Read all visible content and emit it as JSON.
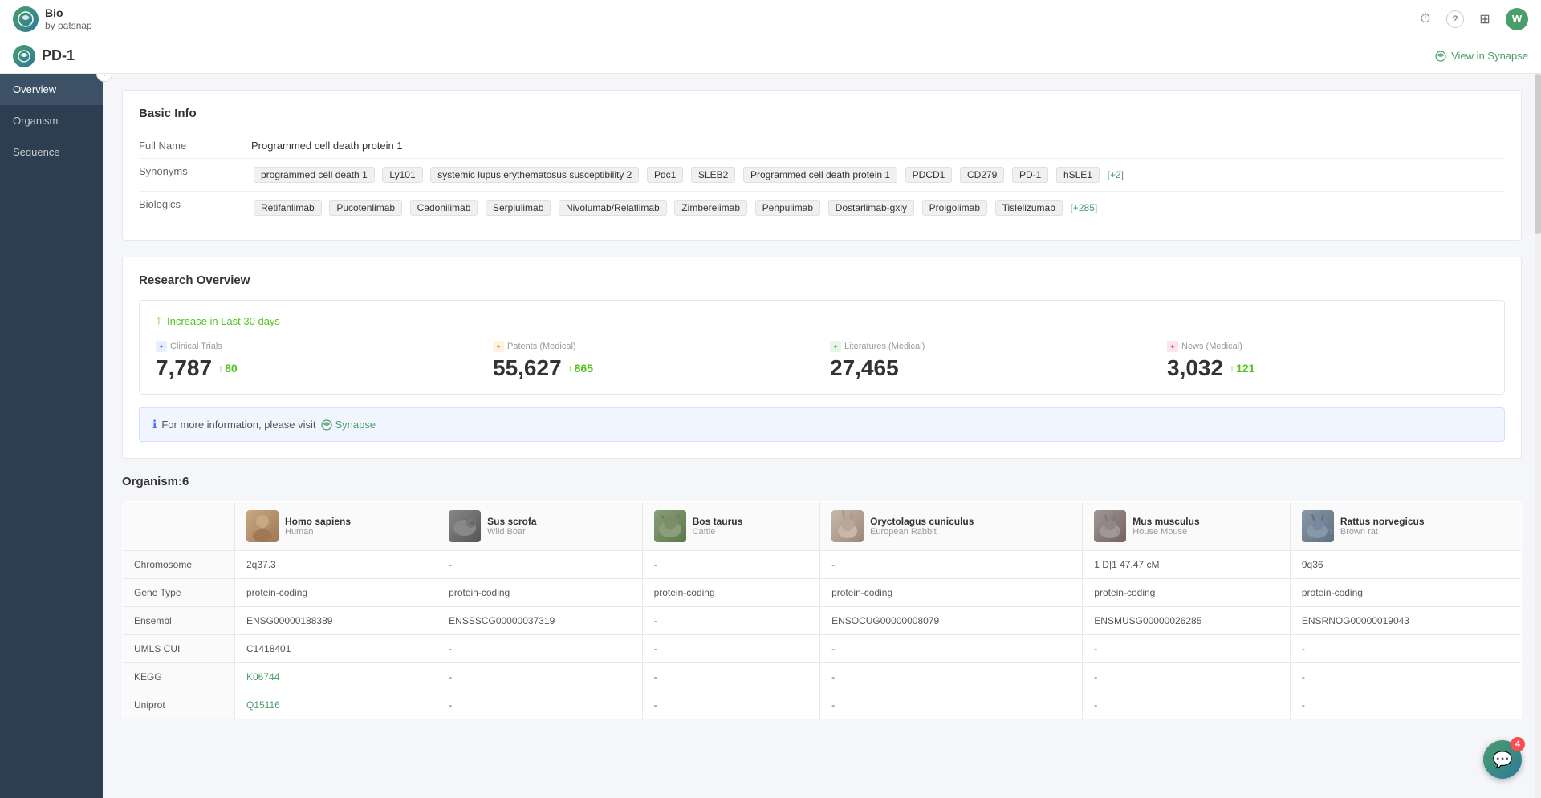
{
  "app": {
    "name": "Bio",
    "subtitle": "by patsnap",
    "avatar": "W",
    "page_title": "PD-1",
    "view_synapse_label": "View in Synapse"
  },
  "nav_icons": {
    "clock": "⏱",
    "help": "?",
    "grid": "⊞"
  },
  "sidebar": {
    "items": [
      {
        "id": "overview",
        "label": "Overview",
        "active": true
      },
      {
        "id": "organism",
        "label": "Organism",
        "active": false
      },
      {
        "id": "sequence",
        "label": "Sequence",
        "active": false
      }
    ],
    "collapse_icon": "‹"
  },
  "basic_info": {
    "section_title": "Basic Info",
    "full_name_label": "Full Name",
    "full_name_value": "Programmed cell death protein 1",
    "synonyms_label": "Synonyms",
    "synonyms": [
      "programmed cell death 1",
      "Ly101",
      "systemic lupus erythematosus susceptibility 2",
      "Pdc1",
      "SLEB2",
      "Programmed cell death protein 1",
      "PDCD1",
      "CD279",
      "PD-1",
      "hSLE1"
    ],
    "synonyms_more": "[+2]",
    "biologics_label": "Biologics",
    "biologics": [
      "Retifanlimab",
      "Pucotenlimab",
      "Cadonilimab",
      "Serplulimab",
      "Nivolumab/Relatlimab",
      "Zimberelimab",
      "Penpulimab",
      "Dostarlimab-gxly",
      "Prolgolimab",
      "Tislelizumab"
    ],
    "biologics_more": "[+285]"
  },
  "research_overview": {
    "section_title": "Research Overview",
    "increase_label": "Increase in Last 30 days",
    "stats": [
      {
        "id": "clinical_trials",
        "label": "Clinical Trials",
        "value": "7,787",
        "delta": "80",
        "icon": "CT"
      },
      {
        "id": "patents",
        "label": "Patents (Medical)",
        "value": "55,627",
        "delta": "865",
        "icon": "P"
      },
      {
        "id": "literatures",
        "label": "Literatures (Medical)",
        "value": "27,465",
        "delta": null,
        "icon": "L"
      },
      {
        "id": "news",
        "label": "News (Medical)",
        "value": "3,032",
        "delta": "121",
        "icon": "N"
      }
    ],
    "info_text": "For more information, please visit",
    "synapse_label": "Synapse"
  },
  "organism": {
    "section_title": "Organism:6",
    "columns": [
      {
        "id": "homo_sapiens",
        "name": "Homo sapiens",
        "subname": "Human",
        "species": "human"
      },
      {
        "id": "sus_scrofa",
        "name": "Sus scrofa",
        "subname": "Wild Boar",
        "species": "boar"
      },
      {
        "id": "bos_taurus",
        "name": "Bos taurus",
        "subname": "Cattle",
        "species": "cattle"
      },
      {
        "id": "oryctolagus",
        "name": "Oryctolagus cuniculus",
        "subname": "European Rabbit",
        "species": "rabbit"
      },
      {
        "id": "mus_musculus",
        "name": "Mus musculus",
        "subname": "House Mouse",
        "species": "mouse"
      },
      {
        "id": "rattus",
        "name": "Rattus norvegicus",
        "subname": "Brown rat",
        "species": "rat"
      }
    ],
    "rows": [
      {
        "label": "Chromosome",
        "values": [
          "2q37.3",
          "-",
          "-",
          "-",
          "1 D|1 47.47 cM",
          "9q36"
        ]
      },
      {
        "label": "Gene Type",
        "values": [
          "protein-coding",
          "protein-coding",
          "protein-coding",
          "protein-coding",
          "protein-coding",
          "protein-coding"
        ]
      },
      {
        "label": "Ensembl",
        "values": [
          "ENSG00000188389",
          "ENSSSCG00000037319",
          "-",
          "ENSOCUG00000008079",
          "ENSMUSG00000026285",
          "ENSRNOG00000019043"
        ]
      },
      {
        "label": "UMLS CUI",
        "values": [
          "C1418401",
          "-",
          "-",
          "-",
          "-",
          "-"
        ]
      },
      {
        "label": "KEGG",
        "values": [
          "K06744",
          "-",
          "-",
          "-",
          "-",
          "-"
        ],
        "links": [
          true,
          false,
          false,
          false,
          false,
          false
        ]
      },
      {
        "label": "Uniprot",
        "values": [
          "Q15116",
          "-",
          "-",
          "-",
          "-",
          "-"
        ],
        "links": [
          true,
          false,
          false,
          false,
          false,
          false
        ]
      }
    ]
  },
  "chat": {
    "badge": "4",
    "icon": "💬"
  }
}
